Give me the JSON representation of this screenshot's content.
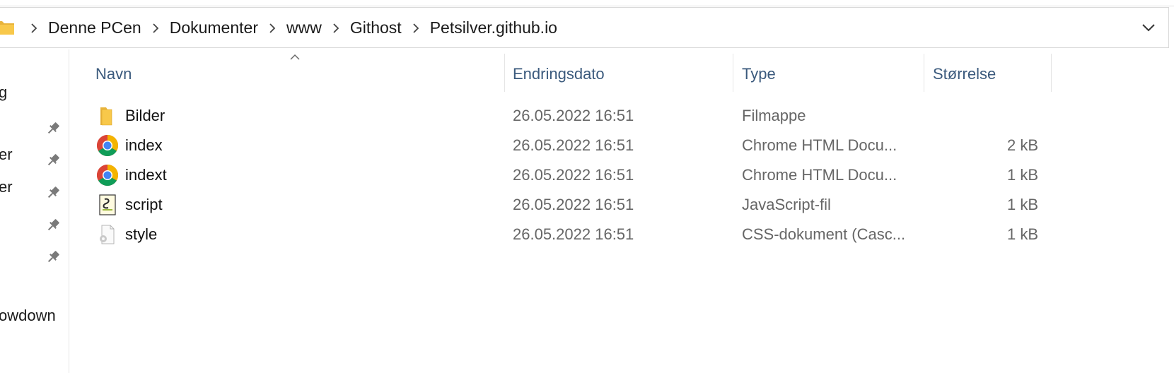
{
  "address_bar": {
    "breadcrumbs": [
      "Denne PCen",
      "Dokumenter",
      "www",
      "Githost",
      "Petsilver.github.io"
    ]
  },
  "nav_pane": {
    "items": [
      {
        "label": "g",
        "pinned": false
      },
      {
        "label": "",
        "pinned": true
      },
      {
        "label": "er",
        "pinned": true
      },
      {
        "label": "er",
        "pinned": true
      },
      {
        "label": "",
        "pinned": true
      },
      {
        "label": "",
        "pinned": true
      },
      {
        "label": "owdown",
        "pinned": false
      }
    ]
  },
  "columns": {
    "name": "Navn",
    "date": "Endringsdato",
    "type": "Type",
    "size": "Størrelse"
  },
  "files": [
    {
      "name": "Bilder",
      "date": "26.05.2022 16:51",
      "type": "Filmappe",
      "size": "",
      "icon": "folder-icon"
    },
    {
      "name": "index",
      "date": "26.05.2022 16:51",
      "type": "Chrome HTML Docu...",
      "size": "2 kB",
      "icon": "chrome-icon"
    },
    {
      "name": "indext",
      "date": "26.05.2022 16:51",
      "type": "Chrome HTML Docu...",
      "size": "1 kB",
      "icon": "chrome-icon"
    },
    {
      "name": "script",
      "date": "26.05.2022 16:51",
      "type": "JavaScript-fil",
      "size": "1 kB",
      "icon": "script-file-icon"
    },
    {
      "name": "style",
      "date": "26.05.2022 16:51",
      "type": "CSS-dokument (Casc...",
      "size": "1 kB",
      "icon": "css-file-icon"
    }
  ],
  "colors": {
    "header_text": "#3b5a7d",
    "secondary_text": "#666666",
    "folder_yellow": "#f8c84a"
  }
}
